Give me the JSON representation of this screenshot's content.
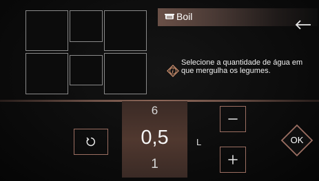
{
  "header": {
    "title": "Boil",
    "icon": "pot-icon",
    "back_icon": "back-arrow-icon"
  },
  "info": {
    "icon": "info-icon",
    "text": "Selecione a quantidade de água em que mergulha os legumes."
  },
  "cooktop_zones": {
    "count": 6,
    "icon": "cooktop-zone-map"
  },
  "quantity": {
    "previous": "6",
    "current": "0,5",
    "next": "1",
    "unit": "L"
  },
  "controls": {
    "reset_icon": "reset-icon",
    "minus_icon": "minus-icon",
    "plus_icon": "plus-icon",
    "ok_label": "OK"
  },
  "colors": {
    "accent": "#9c6f62",
    "header_band": "#6a5047",
    "value_panel": "#50382f",
    "background": "#0b0b0b"
  }
}
